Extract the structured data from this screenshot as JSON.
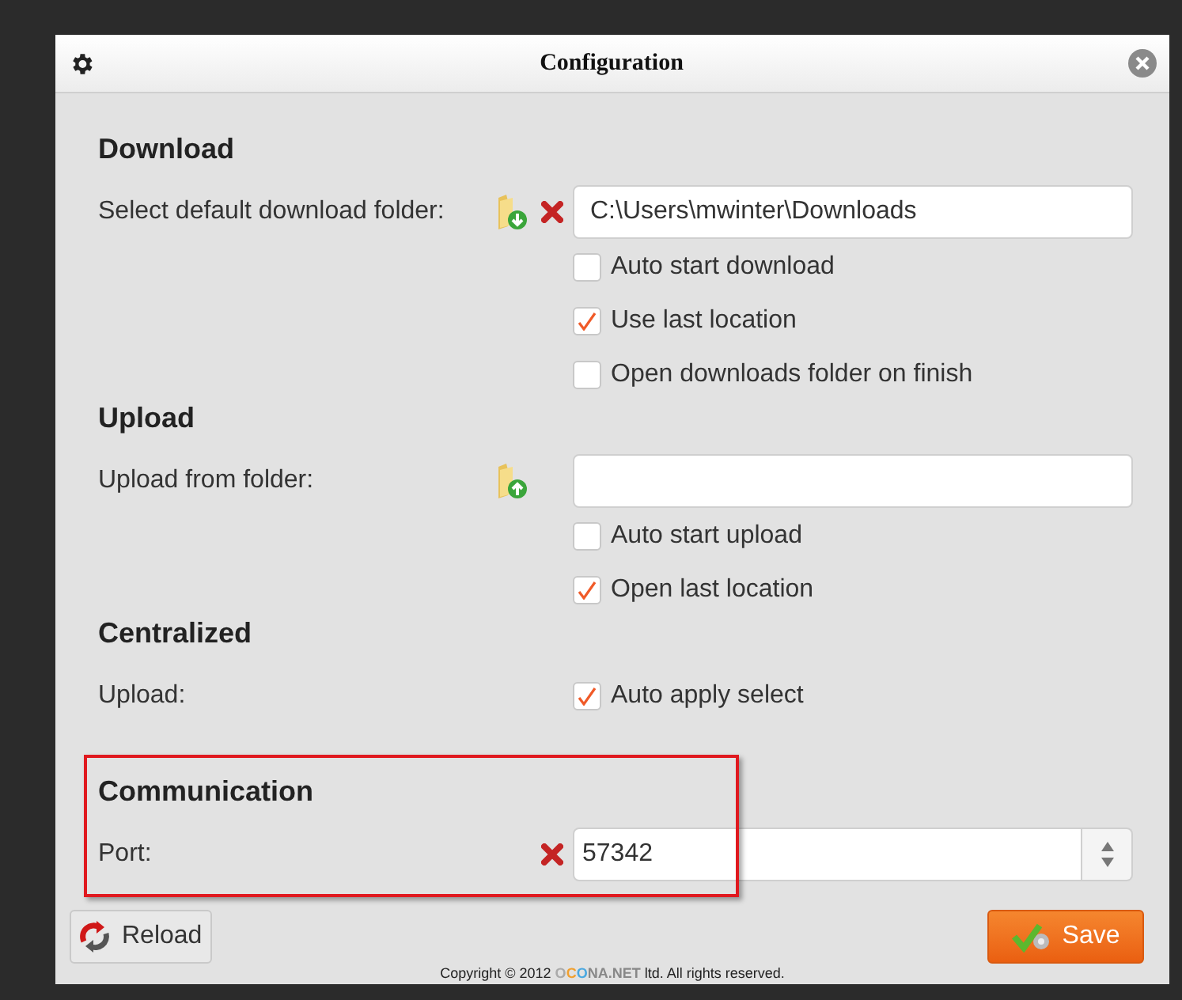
{
  "window": {
    "title": "Configuration"
  },
  "sections": [
    {
      "title": "Download",
      "highlighted": false,
      "rows": [
        {
          "label": "Select default download folder:",
          "kind": "download",
          "clearable": true,
          "value": "C:\\Users\\mwinter\\Downloads"
        }
      ],
      "options": [
        {
          "label": "Auto start download",
          "checked": false
        },
        {
          "label": "Use last location",
          "checked": true
        },
        {
          "label": "Open downloads folder on finish",
          "checked": false
        }
      ]
    },
    {
      "title": "Upload",
      "highlighted": false,
      "rows": [
        {
          "label": "Upload from folder:",
          "kind": "upload",
          "clearable": false
        }
      ],
      "options": [
        {
          "label": "Auto start upload",
          "checked": false
        },
        {
          "label": "Open last location",
          "checked": true
        }
      ]
    },
    {
      "title": "Centralized",
      "highlighted": false,
      "rows": [
        {
          "label": "Upload:",
          "kind": "checkbox",
          "clearable": false,
          "options": [
            {
              "label": "Auto apply select",
              "checked": true
            }
          ]
        }
      ]
    },
    {
      "title": "Communication",
      "highlighted": true,
      "rows": [
        {
          "label": "Port:",
          "kind": "port",
          "clearable": true,
          "value": "57342"
        }
      ]
    }
  ],
  "buttons": {
    "reload": "Reload",
    "save": "Save"
  },
  "copyright": {
    "before": "Copyright © 2012 ",
    "brand_1": "O",
    "brand_2": "C",
    "brand_3": "O",
    "brand_4": "NA.NET",
    "after": " ltd. All rights reserved."
  }
}
